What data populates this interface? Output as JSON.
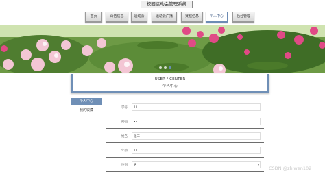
{
  "site": {
    "title": "校园运动会管理系统"
  },
  "nav": {
    "items": [
      {
        "label": "首页",
        "active": false
      },
      {
        "label": "公告信息",
        "active": false
      },
      {
        "label": "运动会",
        "active": false
      },
      {
        "label": "运动会广播",
        "active": false
      },
      {
        "label": "赛程信息",
        "active": false
      },
      {
        "label": "个人中心",
        "active": true
      },
      {
        "label": "后台管理",
        "active": false
      }
    ]
  },
  "banner": {
    "dots": 3,
    "active_dot": 2
  },
  "user_center": {
    "en_title": "USER / CENTER",
    "cn_title": "个人中心"
  },
  "sidebar": {
    "items": [
      {
        "label": "个人中心",
        "active": true
      },
      {
        "label": "我的收藏",
        "active": false
      }
    ]
  },
  "form": {
    "fields": [
      {
        "label": "学号",
        "value": "11",
        "type": "text"
      },
      {
        "label": "密码",
        "value": "••",
        "type": "password"
      },
      {
        "label": "姓名",
        "value": "张三",
        "type": "text"
      },
      {
        "label": "年龄",
        "value": "11",
        "type": "text"
      },
      {
        "label": "性别",
        "value": "男",
        "type": "select"
      }
    ]
  },
  "watermark": "CSDN @zhiwen102",
  "colors": {
    "accent": "#6f8fb6",
    "nav_active_border": "#6c8bb4"
  }
}
